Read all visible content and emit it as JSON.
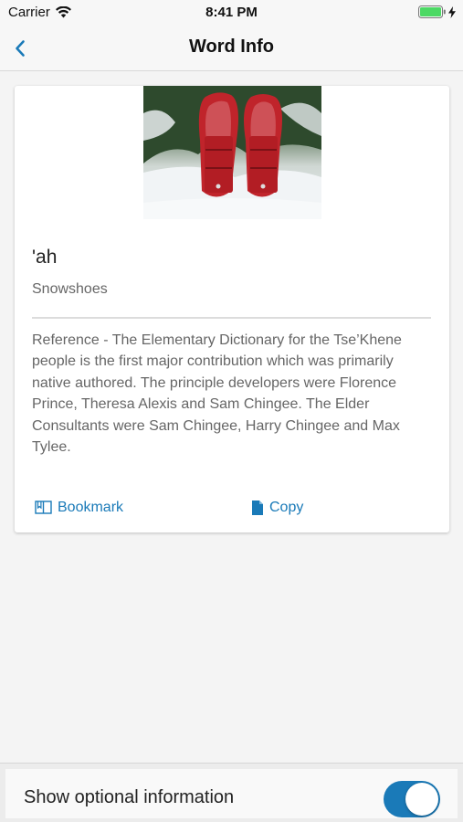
{
  "status_bar": {
    "carrier": "Carrier",
    "time": "8:41 PM"
  },
  "nav": {
    "title": "Word Info",
    "back_icon": "chevron-left-icon"
  },
  "word": {
    "image_subject": "red snowshoes in snow",
    "title": "'ah",
    "translation": "Snowshoes",
    "reference": "Reference - The Elementary Dictionary for the Tse’Khene people is the first major contribution which was primarily native authored. The principle developers were Florence Prince, Theresa Alexis and Sam Chingee. The Elder Consultants were Sam Chingee, Harry Chingee and Max Tylee."
  },
  "actions": {
    "bookmark_label": "Bookmark",
    "bookmark_icon": "bookmark-icon",
    "copy_label": "Copy",
    "copy_icon": "copy-icon"
  },
  "options": {
    "show_optional_label": "Show optional information",
    "show_optional_enabled": true
  },
  "colors": {
    "accent": "#1a7ab8",
    "battery": "#4cd964"
  }
}
